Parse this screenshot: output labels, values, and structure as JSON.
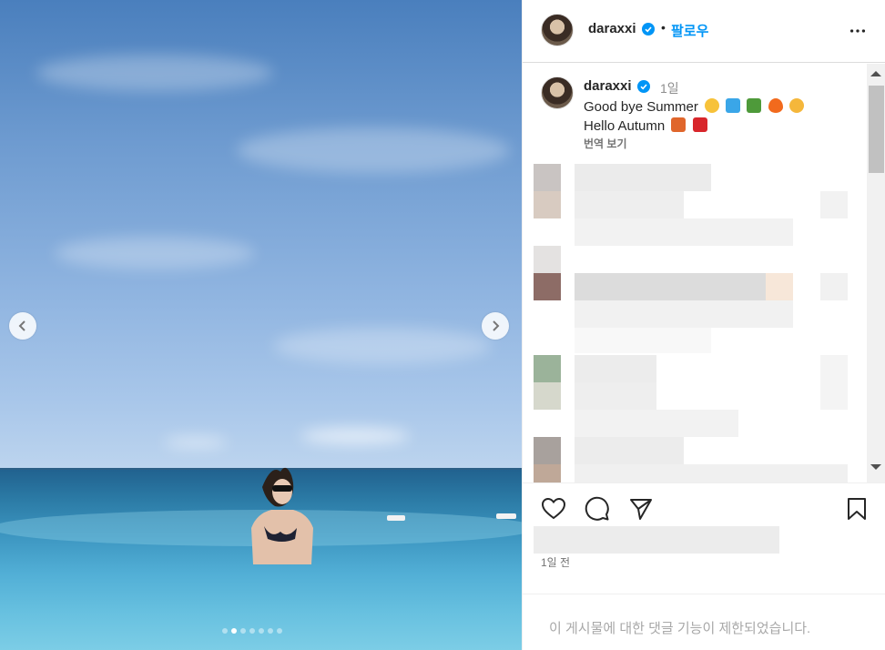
{
  "post": {
    "author": "daraxxi",
    "separator": "•",
    "follow_label": "팔로우",
    "caption": {
      "time": "1일",
      "line1": "Good bye Summer",
      "line2": "Hello Autumn",
      "line1_emojis": [
        "sun-face-emoji",
        "wave-emoji",
        "palm-tree-emoji",
        "fire-emoji",
        "pleading-face-emoji"
      ],
      "line2_emojis": [
        "leaves-emoji",
        "maple-leaf-emoji"
      ],
      "translate_label": "번역 보기"
    },
    "posted_ago": "1일 전",
    "comments_disabled_notice": "이 게시물에 대한 댓글 기능이 제한되었습니다."
  },
  "carousel": {
    "slide_count": 7,
    "active_slide": 2
  },
  "colors": {
    "accent": "#0095f6",
    "verified": "#0095f6",
    "text": "#262626",
    "muted": "#737373"
  },
  "icons": [
    "chevron-left-icon",
    "chevron-right-icon",
    "verified-badge-icon",
    "more-options-icon",
    "heart-icon",
    "comment-icon",
    "share-icon",
    "bookmark-icon"
  ]
}
